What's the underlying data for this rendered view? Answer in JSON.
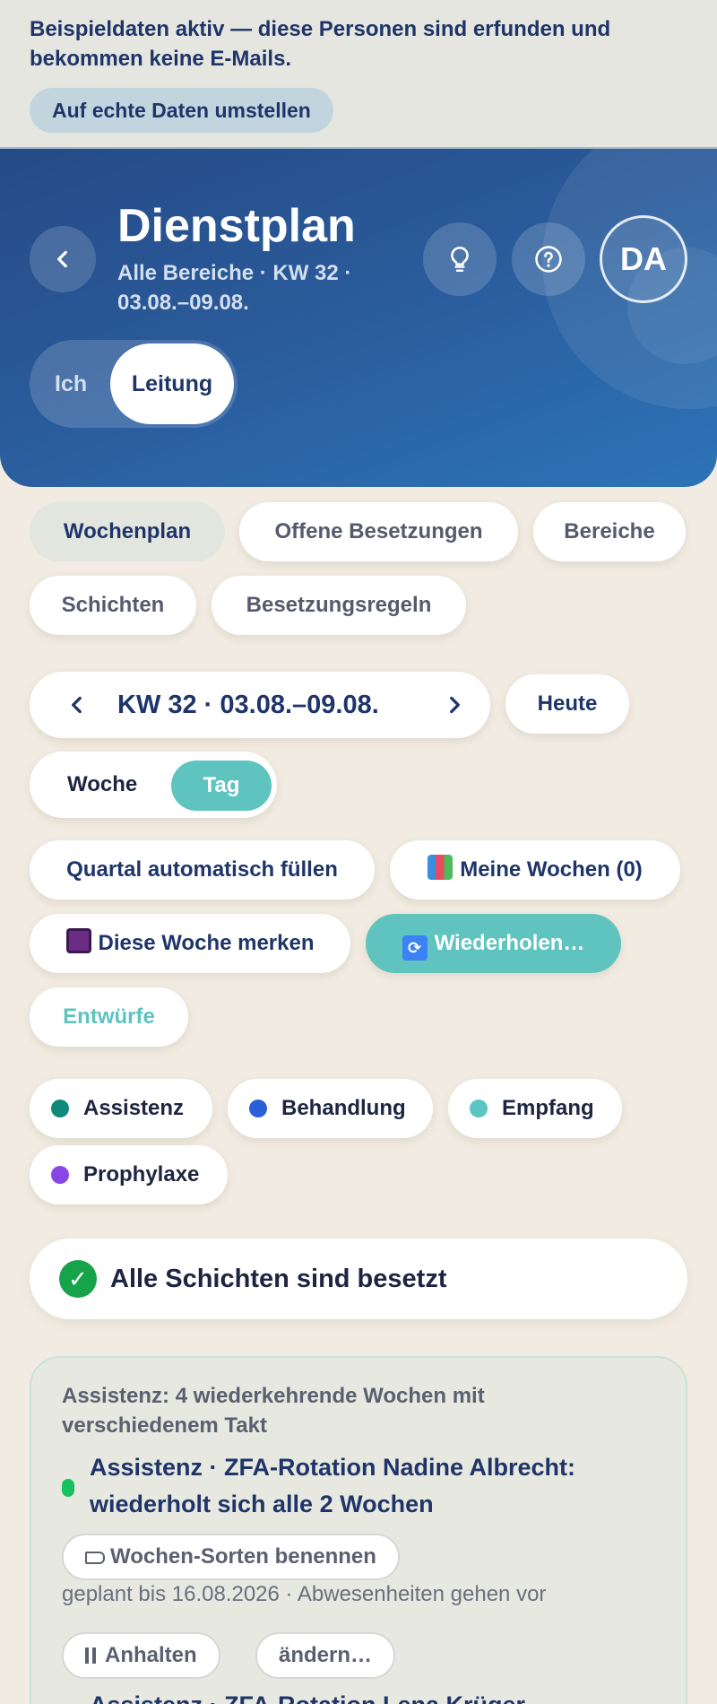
{
  "demo_banner": {
    "message": "Beispieldaten aktiv — diese Personen sind erfunden und bekommen keine E-Mails.",
    "switch_label": "Auf echte Daten umstellen"
  },
  "header": {
    "title": "Dienstplan",
    "subtitle": "Alle Bereiche · KW 32 · 03.08.–09.08.",
    "avatar_initials": "DA",
    "role_toggle": {
      "options": [
        "Ich",
        "Leitung"
      ],
      "selected": "Leitung"
    },
    "icons": [
      "chevron-left-icon",
      "lightbulb-icon",
      "help-icon"
    ]
  },
  "tabs": [
    {
      "label": "Wochenplan",
      "active": true
    },
    {
      "label": "Offene Besetzungen",
      "active": false
    },
    {
      "label": "Bereiche",
      "active": false
    },
    {
      "label": "Schichten",
      "active": false
    },
    {
      "label": "Besetzungsregeln",
      "active": false
    }
  ],
  "week_nav": {
    "label": "KW 32 · 03.08.–09.08.",
    "today_label": "Heute"
  },
  "view_toggle": {
    "options": [
      "Woche",
      "Tag"
    ],
    "selected": "Tag"
  },
  "actions": {
    "autofill": "Quartal automatisch füllen",
    "my_weeks": "Meine Wochen (0)",
    "remember": "Diese Woche merken",
    "repeat": "Wiederholen…",
    "drafts": "Entwürfe"
  },
  "legend": [
    {
      "label": "Assistenz",
      "color": "#0f8a7a"
    },
    {
      "label": "Behandlung",
      "color": "#2a5fd8"
    },
    {
      "label": "Empfang",
      "color": "#5cc4c2"
    },
    {
      "label": "Prophylaxe",
      "color": "#8a45e6"
    }
  ],
  "status": {
    "text": "Alle Schichten sind besetzt",
    "color": "#17a34a"
  },
  "recurring": {
    "header": "Assistenz: 4 wiederkehrende Wochen mit verschiedenem Takt",
    "item": {
      "title": "Assistenz · ZFA-Rotation Nadine Albrecht: wiederholt sich alle 2 Wochen",
      "name_sorts_label": "Wochen-Sorten benennen",
      "planned": "geplant bis 16.08.2026 · Abwesenheiten gehen vor",
      "pause_label": "Anhalten",
      "edit_label": "ändern…"
    },
    "next_item_title": "Assistenz · ZFA-Rotation Lena Krüger"
  }
}
